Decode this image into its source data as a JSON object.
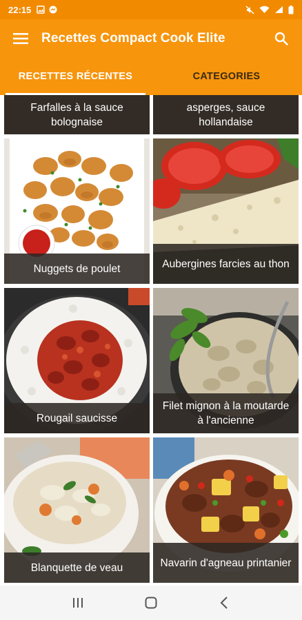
{
  "statusbar": {
    "time": "22:15"
  },
  "appbar": {
    "title": "Recettes Compact Cook Elite"
  },
  "tabs": [
    {
      "label": "RECETTES RÉCENTES",
      "active": true
    },
    {
      "label": "CATEGORIES",
      "active": false
    }
  ],
  "recipes": [
    {
      "title": "Farfalles à la sauce bolognaise"
    },
    {
      "title": "asperges, sauce hollandaise"
    },
    {
      "title": "Nuggets de poulet"
    },
    {
      "title": "Aubergines farcies au thon"
    },
    {
      "title": "Rougail saucisse"
    },
    {
      "title": "Filet mignon à la moutarde à l'ancienne"
    },
    {
      "title": "Blanquette de veau"
    },
    {
      "title": "Navarin d'agneau printanier"
    }
  ],
  "colors": {
    "primary": "#f7950d",
    "statusbar": "#f28a00"
  }
}
